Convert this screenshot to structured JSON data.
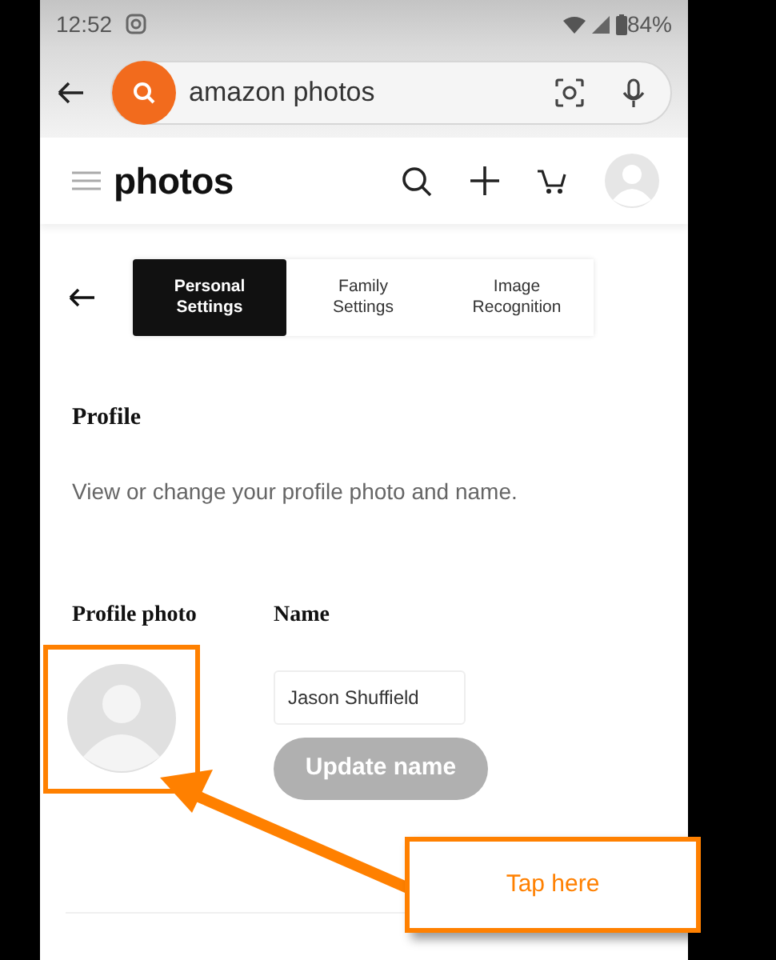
{
  "status_bar": {
    "time": "12:52",
    "battery": "84%"
  },
  "search": {
    "value": "amazon photos"
  },
  "app_header": {
    "title": "photos"
  },
  "tabs": [
    {
      "label": "Personal Settings",
      "selected": true
    },
    {
      "label": "Family Settings",
      "selected": false
    },
    {
      "label": "Image Recognition",
      "selected": false
    }
  ],
  "section": {
    "title": "Profile",
    "description": "View or change your profile photo and name."
  },
  "profile_photo": {
    "label": "Profile photo",
    "highlighted": true
  },
  "name": {
    "label": "Name",
    "value": "Jason Shuffield",
    "button": "Update name",
    "button_disabled": true
  },
  "annotation": {
    "text": "Tap here"
  }
}
